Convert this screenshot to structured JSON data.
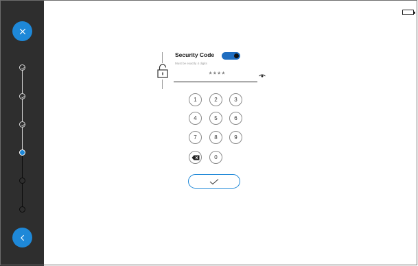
{
  "sidebar": {
    "close_icon": "close-icon",
    "back_icon": "chevron-left-icon",
    "steps": [
      {
        "state": "done"
      },
      {
        "state": "done"
      },
      {
        "state": "done"
      },
      {
        "state": "current"
      },
      {
        "state": "todo"
      },
      {
        "state": "todo"
      }
    ]
  },
  "status": {
    "battery_icon": "battery-icon"
  },
  "security": {
    "title": "Security Code",
    "toggle_on": true,
    "hint": "Must be exactly 4 digits",
    "code_value": "****",
    "lock_icon": "lock-icon",
    "visibility_icon": "eye-icon"
  },
  "keypad": {
    "rows": [
      [
        "1",
        "2",
        "3"
      ],
      [
        "4",
        "5",
        "6"
      ],
      [
        "7",
        "8",
        "9"
      ]
    ],
    "zero": "0",
    "backspace_icon": "backspace-icon"
  },
  "confirm": {
    "icon": "checkmark-icon"
  },
  "colors": {
    "accent": "#1e88d8",
    "toggle": "#1f6dc0",
    "sidebar_bg": "#2e2e2e"
  }
}
